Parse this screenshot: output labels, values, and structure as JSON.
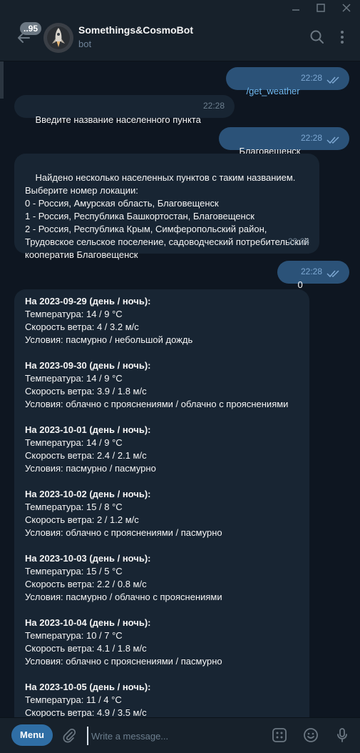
{
  "window": {
    "controls": [
      "minimize",
      "maximize",
      "close"
    ]
  },
  "header": {
    "unread_count": "..95",
    "title": "Somethings&CosmoBot",
    "subtitle": "bot"
  },
  "messages": [
    {
      "dir": "out",
      "text": "/get_weather",
      "time": "22:28",
      "status": "read"
    },
    {
      "dir": "in",
      "text": "Введите название населенного пункта",
      "time": "22:28"
    },
    {
      "dir": "out",
      "text": "Благовещенск",
      "time": "22:28",
      "status": "read"
    },
    {
      "dir": "in",
      "text": "Найдено несколько населенных пунктов с таким названием.\nВыберите номер локации:\n0 - Россия, Амурская область, Благовещенск\n1 - Россия, Республика Башкортостан, Благовещенск\n2 - Россия, Республика Крым, Симферопольский район, Трудовское сельское поселение, садоводческий потребительский кооператив Благовещенск",
      "time": "22:28"
    },
    {
      "dir": "out",
      "text": "0",
      "time": "22:28",
      "status": "read"
    }
  ],
  "forecast": [
    {
      "heading": "На 2023-09-29 (день / ночь):",
      "temp": "Температура: 14 / 9 °C",
      "wind": "Скорость ветра: 4 / 3.2 м/с",
      "cond": "Условия: пасмурно / небольшой дождь"
    },
    {
      "heading": "На 2023-09-30 (день / ночь):",
      "temp": "Температура: 14 / 9 °C",
      "wind": "Скорость ветра: 3.9 / 1.8 м/с",
      "cond": "Условия: облачно с прояснениями / облачно с прояснениями"
    },
    {
      "heading": "На 2023-10-01 (день / ночь):",
      "temp": "Температура: 14 / 9 °C",
      "wind": "Скорость ветра: 2.4 / 2.1 м/с",
      "cond": "Условия: пасмурно / пасмурно"
    },
    {
      "heading": "На 2023-10-02 (день / ночь):",
      "temp": "Температура: 15 / 8 °C",
      "wind": "Скорость ветра: 2 / 1.2 м/с",
      "cond": "Условия: облачно с прояснениями / пасмурно"
    },
    {
      "heading": "На 2023-10-03 (день / ночь):",
      "temp": "Температура: 15 / 5 °C",
      "wind": "Скорость ветра: 2.2 / 0.8 м/с",
      "cond": "Условия: пасмурно / облачно с прояснениями"
    },
    {
      "heading": "На 2023-10-04 (день / ночь):",
      "temp": "Температура: 10 / 7 °C",
      "wind": "Скорость ветра: 4.1 / 1.8 м/с",
      "cond": "Условия: облачно с прояснениями / пасмурно"
    },
    {
      "heading": "На 2023-10-05 (день / ночь):",
      "temp": "Температура: 11 / 4 °C",
      "wind": "Скорость ветра: 4.9 / 3.5 м/с",
      "cond": ""
    }
  ],
  "composer": {
    "menu_label": "Menu",
    "placeholder": "Write a message..."
  },
  "icons": {
    "back": "arrow-left-icon",
    "search": "search-icon",
    "more": "more-vertical-icon",
    "attach": "paperclip-icon",
    "commands": "commands-icon",
    "emoji": "emoji-icon",
    "mic": "microphone-icon"
  },
  "colors": {
    "background": "#0e1621",
    "panel": "#17212b",
    "incoming_bubble": "#182533",
    "outgoing_bubble": "#2b5278",
    "accent": "#2f6ea5",
    "read_check": "#7da8d3"
  }
}
